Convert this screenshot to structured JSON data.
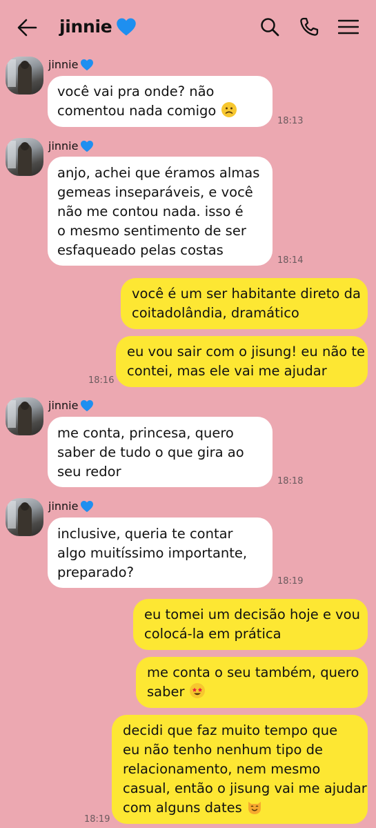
{
  "header": {
    "contact_name": "jinnie",
    "heart_icon": "blue-heart-icon",
    "back_icon": "arrow-left-icon",
    "search_icon": "search-icon",
    "call_icon": "phone-icon",
    "menu_icon": "hamburger-menu-icon"
  },
  "colors": {
    "background": "#eca8b1",
    "incoming_bubble": "#ffffff",
    "outgoing_bubble": "#fde733",
    "heart": "#1e90ff"
  },
  "messages": [
    {
      "from": "jinnie",
      "sender_label": "jinnie",
      "lines": [
        "você vai pra onde? não",
        "comentou nada comigo"
      ],
      "emoji": "slightly-frowning-face",
      "time": "18:13"
    },
    {
      "from": "jinnie",
      "sender_label": "jinnie",
      "lines": [
        "anjo, achei que éramos almas",
        "gemeas inseparáveis, e você",
        "não me contou nada. isso é",
        "o mesmo sentimento de ser",
        "esfaqueado pelas costas"
      ],
      "time": "18:14"
    },
    {
      "from": "me",
      "lines": [
        "você é um ser habitante direto da",
        "coitadolândia, dramático"
      ]
    },
    {
      "from": "me",
      "lines": [
        "eu vou sair com o jisung! eu não te",
        "contei, mas ele vai me ajudar"
      ],
      "time": "18:16"
    },
    {
      "from": "jinnie",
      "sender_label": "jinnie",
      "lines": [
        "me conta, princesa, quero",
        "saber de tudo o que gira ao",
        "seu redor"
      ],
      "time": "18:18"
    },
    {
      "from": "jinnie",
      "sender_label": "jinnie",
      "lines": [
        "inclusive, queria te contar",
        "algo muitíssimo importante,",
        "preparado?"
      ],
      "time": "18:19"
    },
    {
      "from": "me",
      "lines": [
        "eu tomei um decisão hoje e vou",
        "colocá-la em prática"
      ]
    },
    {
      "from": "me",
      "lines": [
        "me conta o seu também, quero",
        "saber"
      ],
      "emoji": "star-struck-face"
    },
    {
      "from": "me",
      "lines": [
        "decidi que faz muito tempo que",
        "eu não tenho nenhum tipo de",
        "relacionamento, nem mesmo",
        "casual, então o jisung vai me ajudar",
        "com alguns dates"
      ],
      "emoji": "smiling-cat-face",
      "time": "18:19"
    }
  ]
}
